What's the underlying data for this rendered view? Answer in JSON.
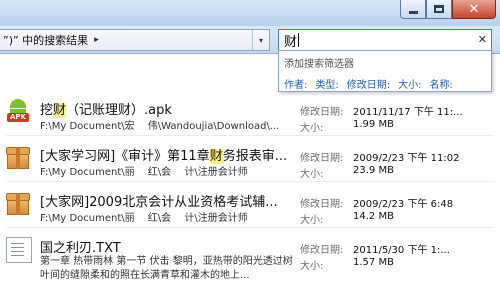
{
  "window": {
    "minimize_icon": "minimize-icon",
    "maximize_icon": "maximize-icon",
    "close_icon": "close-icon",
    "close_glyph": "✕"
  },
  "address_bar": {
    "text": "”)” 中的搜索结果",
    "arrow": "▸",
    "dropdown": "▾"
  },
  "search": {
    "query": "财",
    "clear_glyph": "✕"
  },
  "filter_menu": {
    "title": "添加搜索筛选器",
    "filters": [
      "作者:",
      "类型:",
      "修改日期:",
      "大小:",
      "名称:"
    ]
  },
  "files": [
    {
      "name_parts": [
        "挖",
        "财",
        "（记账理财）.apk"
      ],
      "path": "F:\\My Document\\宏　 伟\\Wandoujia\\Download\\...",
      "modified_label": "修改日期:",
      "modified": "2011/11/17 下午 11:...",
      "size_label": "大小:",
      "size": "1.99 MB",
      "icon": "android-apk-icon"
    },
    {
      "name_parts": [
        "[大家学习网]《审计》第11章",
        "财",
        "务报表审..."
      ],
      "path": "F:\\My Document\\丽　 红\\会　 计\\注册会计师",
      "modified_label": "修改日期:",
      "modified": "2009/2/23 下午 11:02",
      "size_label": "大小:",
      "size": "23.9 MB",
      "icon": "archive-icon"
    },
    {
      "name_parts": [
        "[大家网]2009北京会计从业资格考试辅...",
        "",
        ""
      ],
      "path": "F:\\My Document\\丽　 红\\会　 计\\注册会计师",
      "modified_label": "修改日期:",
      "modified": "2009/2/23 下午 6:48",
      "size_label": "大小:",
      "size": "14.2 MB",
      "icon": "archive-icon"
    },
    {
      "name_parts": [
        "国之利刃.TXT",
        "",
        ""
      ],
      "path": "第一章 热带雨林 第一节 伏击 黎明，亚热带的阳光透过树叶间的缝隙柔和的照在长满青草和灌木的地上...",
      "modified_label": "修改日期:",
      "modified": "2011/5/30 下午 1:...",
      "size_label": "大小:",
      "size": "1.57 MB",
      "icon": "text-file-icon"
    }
  ]
}
